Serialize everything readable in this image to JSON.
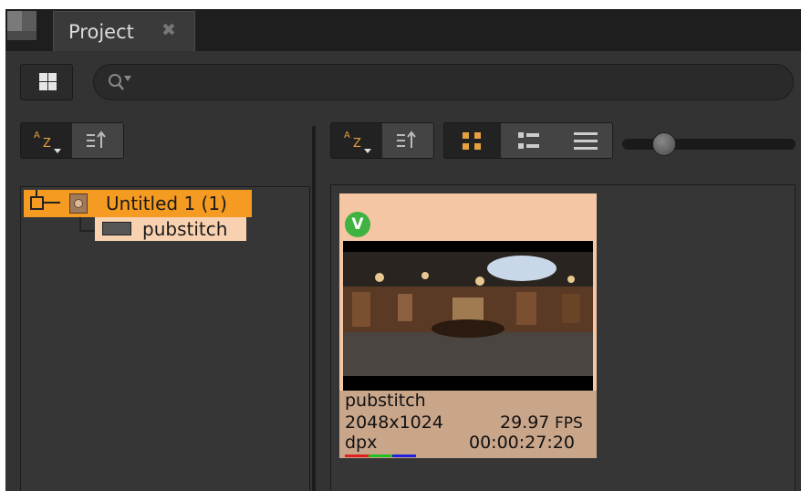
{
  "tab": {
    "label": "Project",
    "close": "✖"
  },
  "search": {
    "placeholder": ""
  },
  "sort": {
    "az_label": "A Z"
  },
  "tree": {
    "root_label": "Untitled 1 (1)",
    "child_label": "pubstitch"
  },
  "card": {
    "badge": "V",
    "name": "pubstitch",
    "resolution": "2048x1024",
    "fps": "29.97",
    "fps_unit": "FPS",
    "format": "dpx",
    "timecode": "00:00:27:20"
  },
  "thumb_size_slider": {
    "value": 0.2
  },
  "colors": {
    "accent": "#f59b22",
    "selection_light": "#f8d2b0",
    "card_bg": "#f4c6a3",
    "card_info": "#c9a58a",
    "badge": "#3fb33f"
  }
}
